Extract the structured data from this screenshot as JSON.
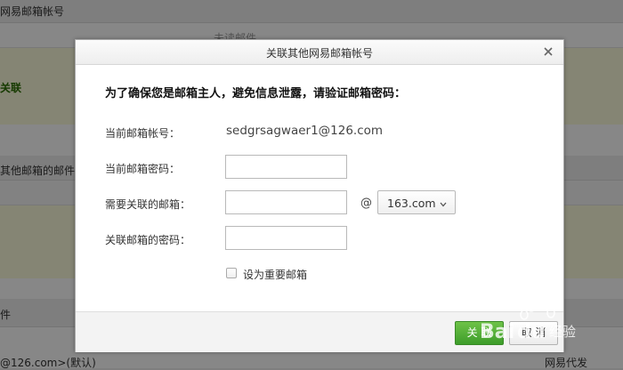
{
  "background": {
    "header_text": "网易邮箱帐号",
    "unread_label": "未读邮件",
    "link_text": "关联",
    "other_mail_text": "其他邮箱的邮件",
    "section_text": "件",
    "bottom_left_text": "@126.com>(默认)",
    "bottom_right_text": "网易代发"
  },
  "dialog": {
    "title": "关联其他网易邮箱帐号",
    "heading": "为了确保您是邮箱主人，避免信息泄露，请验证邮箱密码：",
    "current_account_label": "当前邮箱帐号：",
    "current_account_value": "sedgrsagwaer1@126.com",
    "current_password_label": "当前邮箱密码：",
    "link_mailbox_label": "需要关联的邮箱：",
    "at_sign": "@",
    "domain_selected": "163.com",
    "link_password_label": "关联邮箱的密码：",
    "important_checkbox_label": "设为重要邮箱",
    "ok_button": "关 联",
    "cancel_button": "取 消"
  },
  "watermark": {
    "text": "Baidu 经验"
  },
  "colors": {
    "ok_button": "#4aa832",
    "overlay": "rgba(0,0,0,0.47)"
  }
}
